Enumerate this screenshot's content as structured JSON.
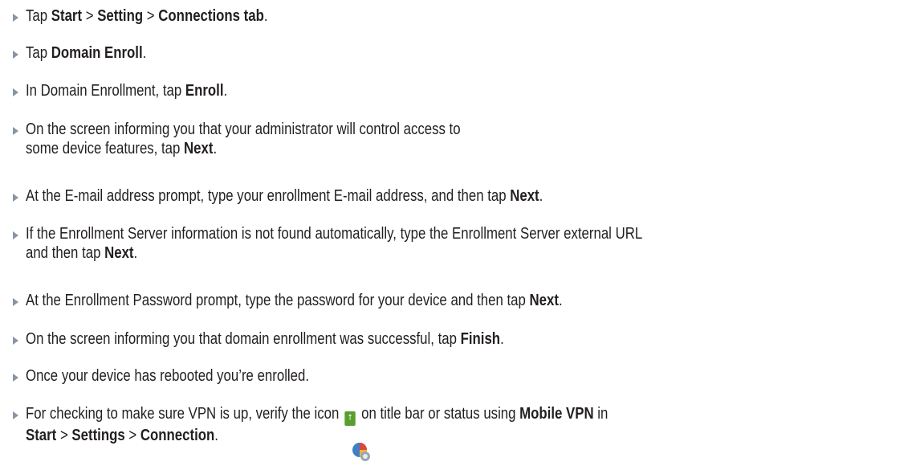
{
  "steps": [
    {
      "parts": [
        {
          "t": "Tap "
        },
        {
          "t": "Start",
          "b": true
        },
        {
          "t": " > "
        },
        {
          "t": "Setting",
          "b": true
        },
        {
          "t": " > "
        },
        {
          "t": "Connections tab",
          "b": true
        },
        {
          "t": "."
        }
      ]
    },
    {
      "parts": [
        {
          "t": "Tap "
        },
        {
          "t": "Domain Enroll",
          "b": true
        },
        {
          "t": "."
        }
      ]
    },
    {
      "parts": [
        {
          "t": "In Domain Enrollment, tap "
        },
        {
          "t": "Enroll",
          "b": true
        },
        {
          "t": "."
        }
      ]
    },
    {
      "parts": [
        {
          "t": "On the screen informing you that your administrator will control access to"
        },
        {
          "br": true
        },
        {
          "t": "some device features, tap "
        },
        {
          "t": "Next",
          "b": true
        },
        {
          "t": "."
        }
      ]
    },
    {
      "parts": [
        {
          "t": "At the E-mail address prompt, type your enrollment E-mail address, and then tap "
        },
        {
          "t": "Next",
          "b": true
        },
        {
          "t": "."
        }
      ]
    },
    {
      "parts": [
        {
          "t": "If the Enrollment Server information is not found automatically, type the Enrollment Server external URL"
        },
        {
          "br": true
        },
        {
          "t": "and then tap "
        },
        {
          "t": "Next",
          "b": true
        },
        {
          "t": "."
        }
      ]
    },
    {
      "parts": [
        {
          "t": "At the Enrollment Password prompt, type the password for your device and then tap "
        },
        {
          "t": "Next",
          "b": true
        },
        {
          "t": "."
        }
      ]
    },
    {
      "parts": [
        {
          "t": "On the screen informing you that domain enrollment was successful, tap "
        },
        {
          "t": "Finish",
          "b": true
        },
        {
          "t": "."
        }
      ]
    },
    {
      "parts": [
        {
          "t": "Once your device has rebooted you’re enrolled."
        }
      ]
    },
    {
      "parts": [
        {
          "t": "For checking to make sure VPN is up, verify the icon "
        },
        {
          "icon": "vpn-status-icon"
        },
        {
          "t": " on title bar or status using "
        },
        {
          "t": "Mobile VPN",
          "b": true
        },
        {
          "t": " in"
        },
        {
          "br": true
        },
        {
          "t": "Start",
          "b": true
        },
        {
          "t": " > "
        },
        {
          "t": "Settings",
          "b": true
        },
        {
          "t": " > "
        },
        {
          "t": "Connection",
          "b": true
        },
        {
          "t": "."
        }
      ]
    }
  ],
  "trailing_icon": "connections-icon",
  "colors": {
    "bullet": "#8a95a3",
    "text": "#231f20",
    "vpn_icon": "#5a9e2f"
  }
}
